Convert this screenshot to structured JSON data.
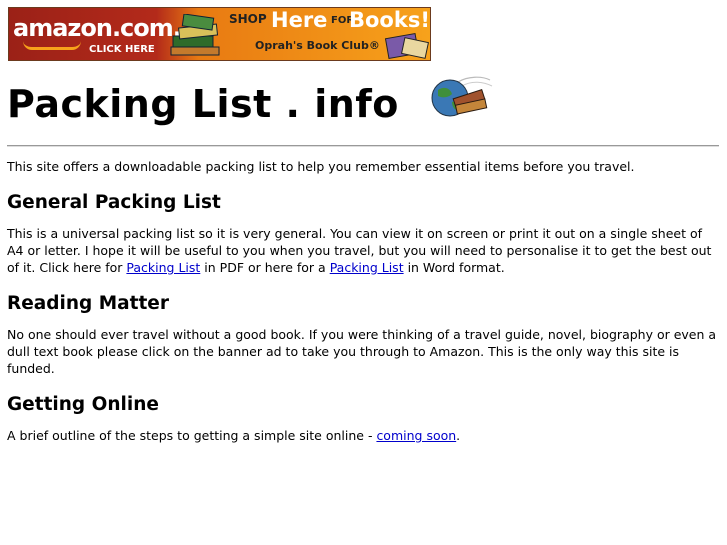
{
  "banner": {
    "brand": "amazon.com.",
    "click": "CLICK HERE",
    "shop": "SHOP",
    "here": "Here",
    "for": "FOR",
    "books": "Books!",
    "oprah": "Oprah's Book Club®"
  },
  "header": {
    "title": "Packing List . info"
  },
  "intro": "This site offers a downloadable packing list to help you remember essential items before you travel.",
  "general": {
    "heading": "General Packing List",
    "text1": "This is a universal packing list so it is very general. You can view it on screen or print it out on a single sheet of A4 or letter. I hope it will be useful to you when you travel, but you will need to personalise it to get the best out of it. Click here for ",
    "link1": "Packing List",
    "text2": " in PDF or here for a ",
    "link2": "Packing List",
    "text3": " in Word format."
  },
  "reading": {
    "heading": "Reading Matter",
    "text": "No one should ever travel without a good book. If you were thinking of a travel guide, novel, biography or even a dull text book please click on the banner ad to take you through to Amazon. This is the only way this site is funded."
  },
  "online": {
    "heading": "Getting Online",
    "text1": "A brief outline of the steps to getting a simple site online - ",
    "link": "coming soon",
    "text2": "."
  },
  "colors": {
    "link": "#0000cc",
    "banner_red": "#b32a1a",
    "banner_orange": "#f7a21b"
  },
  "icons": {
    "banner_art": "books-stack-icon",
    "title_art": "globe-with-books-icon"
  }
}
